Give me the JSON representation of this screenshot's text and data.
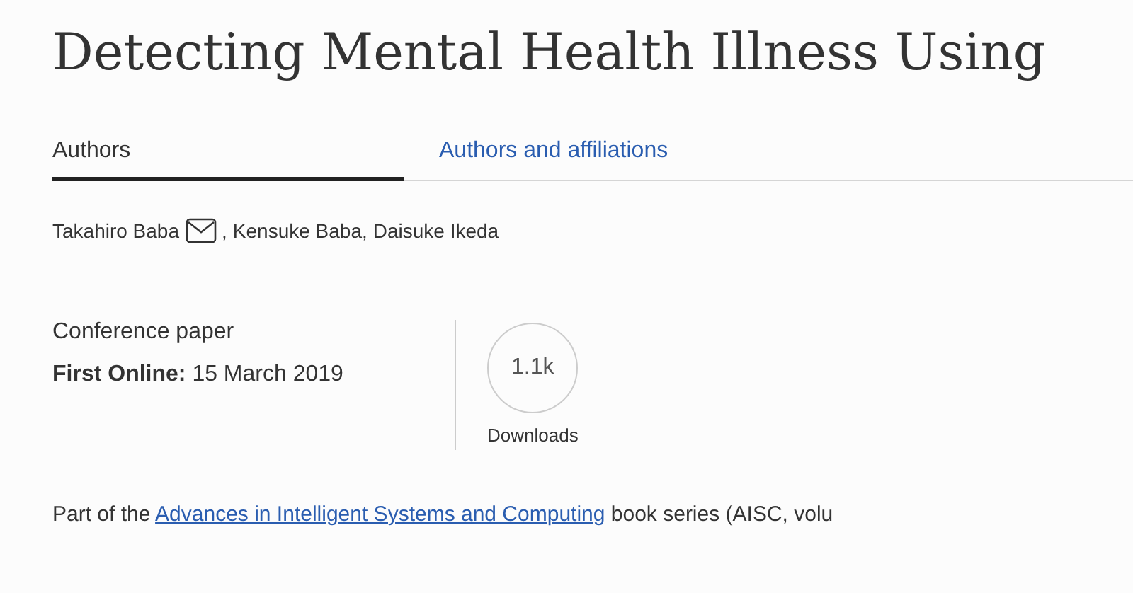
{
  "title": "Detecting Mental Health Illness Using",
  "tabs": [
    {
      "label": "Authors",
      "selected": true
    },
    {
      "label": "Authors and affiliations",
      "selected": false
    }
  ],
  "authors": [
    {
      "name": "Takahiro Baba",
      "email": true,
      "separator": ","
    },
    {
      "name": "Kensuke Baba",
      "email": false,
      "separator": ","
    },
    {
      "name": "Daisuke Ikeda",
      "email": false
    }
  ],
  "content_type": "Conference paper",
  "first_online": {
    "label": "First Online:",
    "date": "15 March 2019"
  },
  "downloads": {
    "count": "1.1k",
    "label": "Downloads"
  },
  "series": {
    "prefix": "Part of the",
    "link": "Advances in Intelligent Systems and Computing",
    "suffix": "book series (AISC, volu"
  }
}
